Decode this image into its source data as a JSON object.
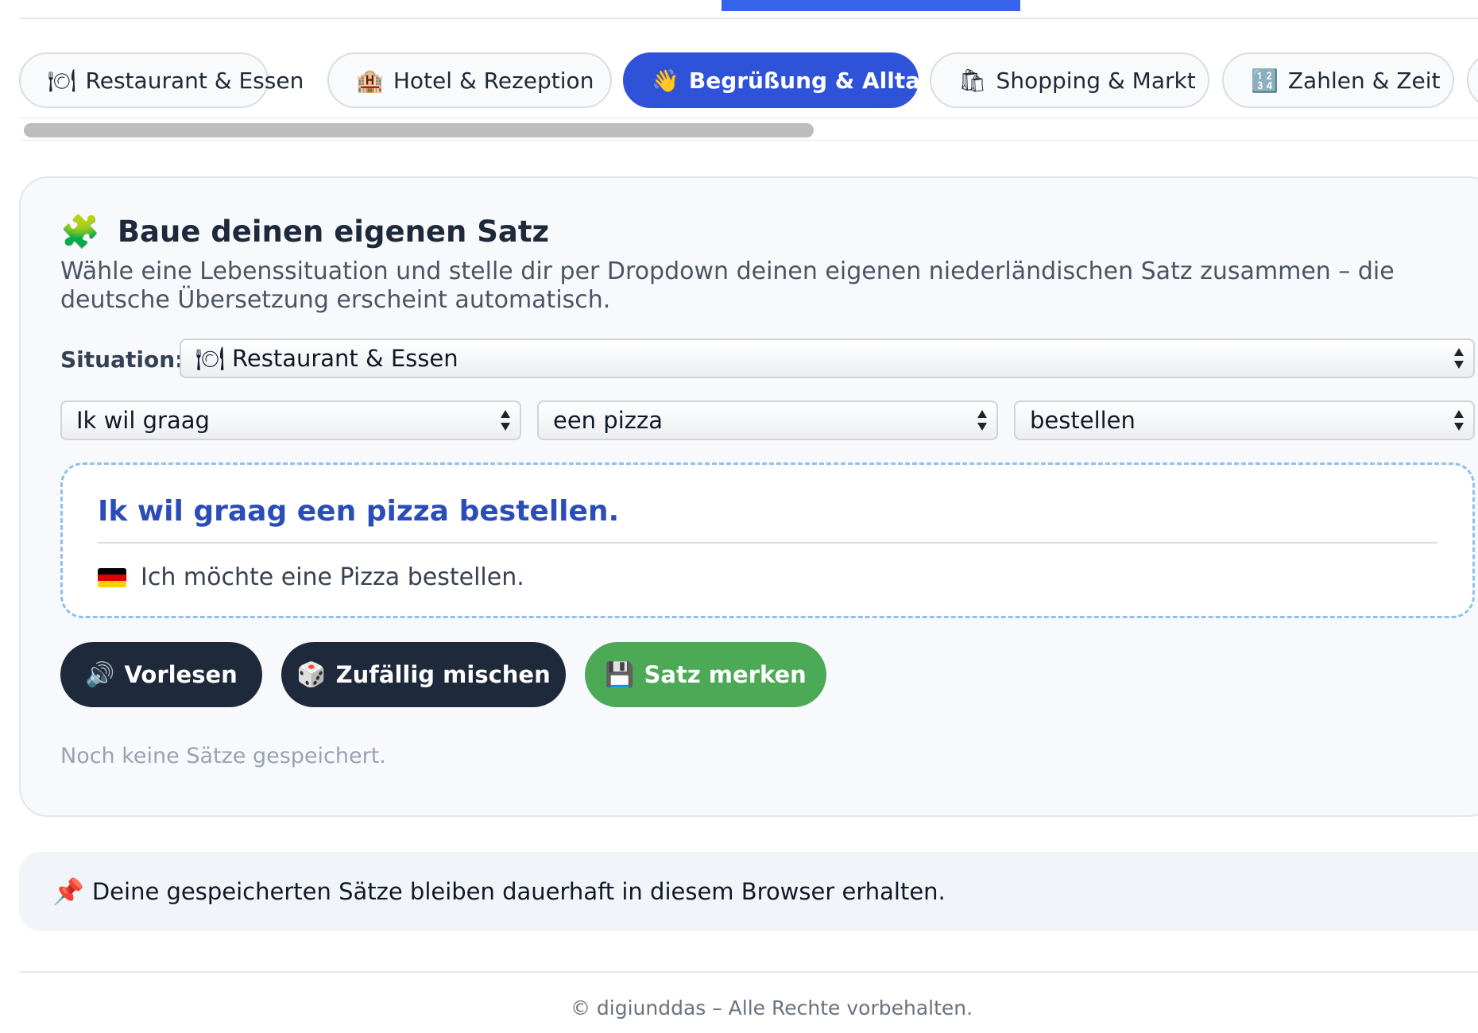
{
  "tabs": [
    {
      "icon": "🍽",
      "label": "Restaurant & Essen",
      "active": false
    },
    {
      "icon": "🏨",
      "label": "Hotel & Rezeption",
      "active": false
    },
    {
      "icon": "👋",
      "label": "Begrüßung & Alltag",
      "active": true
    },
    {
      "icon": "🛍",
      "label": "Shopping & Markt",
      "active": false
    },
    {
      "icon": "🔢",
      "label": "Zahlen & Zeit",
      "active": false
    }
  ],
  "builder": {
    "title_icon": "puzzle-icon",
    "title_glyph": "🧩",
    "title": "Baue deinen eigenen Satz",
    "description": "Wähle eine Lebenssituation und stelle dir per Dropdown deinen eigenen niederländischen Satz zusammen – die deutsche Übersetzung erscheint automatisch.",
    "situation_label": "Situation:",
    "situation_value": "🍽 Restaurant & Essen",
    "part1": "Ik wil graag",
    "part2": "een pizza",
    "part3": "bestellen",
    "result_nl": "Ik wil graag een pizza bestellen.",
    "result_de": "Ich möchte eine Pizza bestellen.",
    "buttons": {
      "read_icon": "🔊",
      "read": "Vorlesen",
      "shuffle_icon": "🎲",
      "shuffle": "Zufällig mischen",
      "save_icon": "💾",
      "save": "Satz merken"
    },
    "saved_empty": "Noch keine Sätze gespeichert."
  },
  "note": {
    "icon": "📌",
    "text": "Deine gespeicherten Sätze bleiben dauerhaft in diesem Browser erhalten."
  },
  "footer": "© digiunddas – Alle Rechte vorbehalten.",
  "colors": {
    "accent": "#2f53d8",
    "save_green": "#4caa57",
    "dark_button": "#1e293b",
    "result_blue": "#2a4db8"
  }
}
